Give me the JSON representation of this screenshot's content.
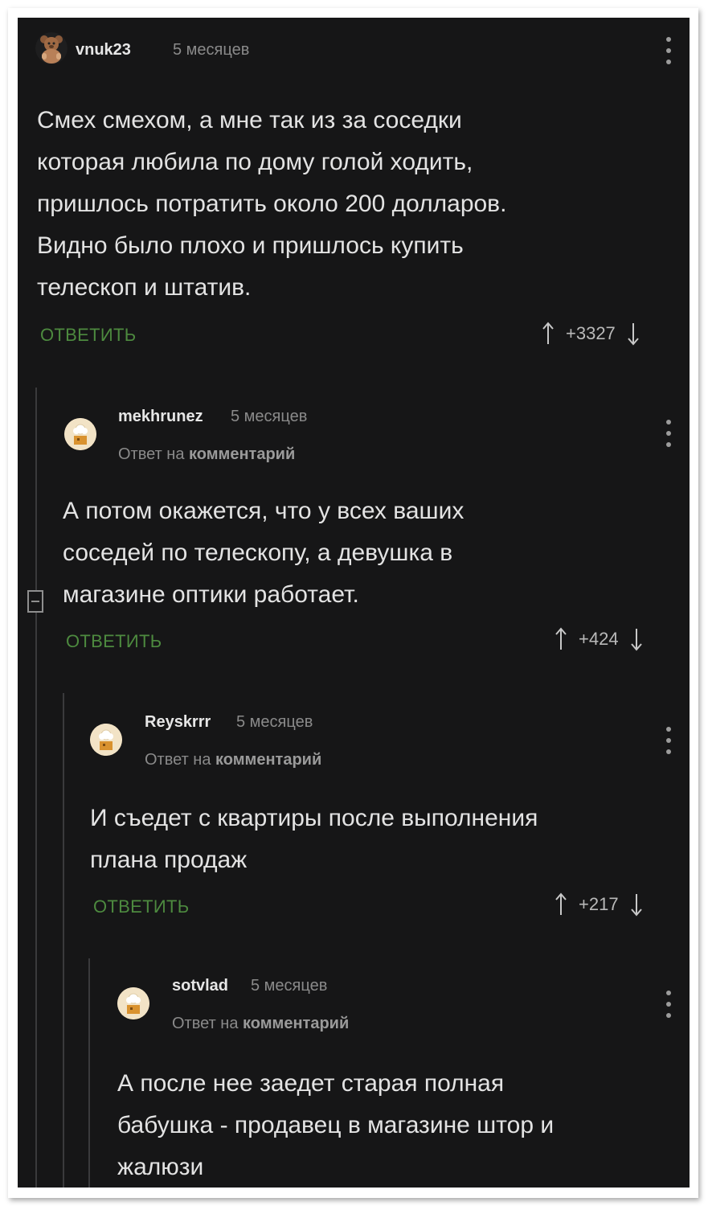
{
  "comments": [
    {
      "username": "vnuk23",
      "time": "5 месяцев",
      "text": "Смех смехом, а мне так из за соседки\nкоторая любила по дому голой ходить,\nпришлось потратить около 200 долларов.\nВидно было плохо и пришлось купить\nтелескоп и штатив.",
      "reply_label": "ОТВЕТИТЬ",
      "rating": "+3327",
      "avatar_icon": "bear-avatar"
    },
    {
      "username": "mekhrunez",
      "time": "5 месяцев",
      "reply_prefix": "Ответ на",
      "reply_target": "комментарий",
      "text": "А потом окажется, что у всех ваших\nсоседей по телескопу, а девушка в\nмагазине оптики работает.",
      "reply_label": "ОТВЕТИТЬ",
      "rating": "+424",
      "avatar_icon": "chef-avatar"
    },
    {
      "username": "Reyskrrr",
      "time": "5 месяцев",
      "reply_prefix": "Ответ на",
      "reply_target": "комментарий",
      "text": "И съедет с квартиры после выполнения\nплана продаж",
      "reply_label": "ОТВЕТИТЬ",
      "rating": "+217",
      "avatar_icon": "chef-avatar"
    },
    {
      "username": "sotvlad",
      "time": "5 месяцев",
      "reply_prefix": "Ответ на",
      "reply_target": "комментарий",
      "text": "А после нее заедет старая полная\nбабушка - продавец в магазине штор и\nжалюзи",
      "avatar_icon": "chef-avatar"
    }
  ],
  "colors": {
    "background": "#161617",
    "reply_link": "#4d8a3f",
    "text": "#e3e3e3",
    "muted": "#8a8a8a"
  }
}
